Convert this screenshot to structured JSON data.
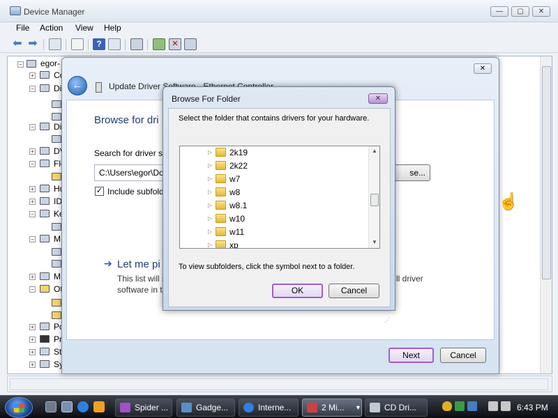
{
  "device_manager": {
    "title": "Device Manager",
    "caption_min": "—",
    "caption_max": "▢",
    "caption_close": "✕",
    "menu": [
      "File",
      "Action",
      "View",
      "Help"
    ],
    "tree": {
      "root": "egor-",
      "items": [
        "Co",
        "Di",
        "Di",
        "DV",
        "Fle",
        "Hu",
        "ID",
        "Ke",
        "M",
        "M",
        "Ot",
        "Po",
        "Pr",
        "St",
        "Sy"
      ]
    }
  },
  "wizard": {
    "title": "Update Driver Software - Ethernet Controller",
    "close": "✕",
    "back": "←",
    "heading": "Browse for dri",
    "search_label": "Search for driver so",
    "path_value": "C:\\Users\\egor\\Do",
    "browse_label": "se...",
    "include_checked": true,
    "include_label": "Include subfold",
    "let_me": "Let me pi",
    "let_me_desc_1": "This list will s",
    "let_me_desc_2": "software in t",
    "let_me_tail": "ll driver",
    "next_label": "Next",
    "cancel_label": "Cancel"
  },
  "browse_dialog": {
    "title": "Browse For Folder",
    "close": "✕",
    "instruction": "Select the folder that contains drivers for your hardware.",
    "folders": [
      "2k19",
      "2k22",
      "w7",
      "w8",
      "w8.1",
      "w10",
      "w11",
      "xp"
    ],
    "hint": "To view subfolders, click the symbol next to a folder.",
    "ok_label": "OK",
    "cancel_label": "Cancel"
  },
  "taskbar": {
    "tasks": [
      "Spider ...",
      "Gadge...",
      "Interne...",
      "2 Mi...",
      "CD Dri..."
    ],
    "clock": "6:43 PM"
  },
  "colors": {
    "accent_purple": "#a25bd0",
    "heading_blue": "#1e3d7b"
  }
}
